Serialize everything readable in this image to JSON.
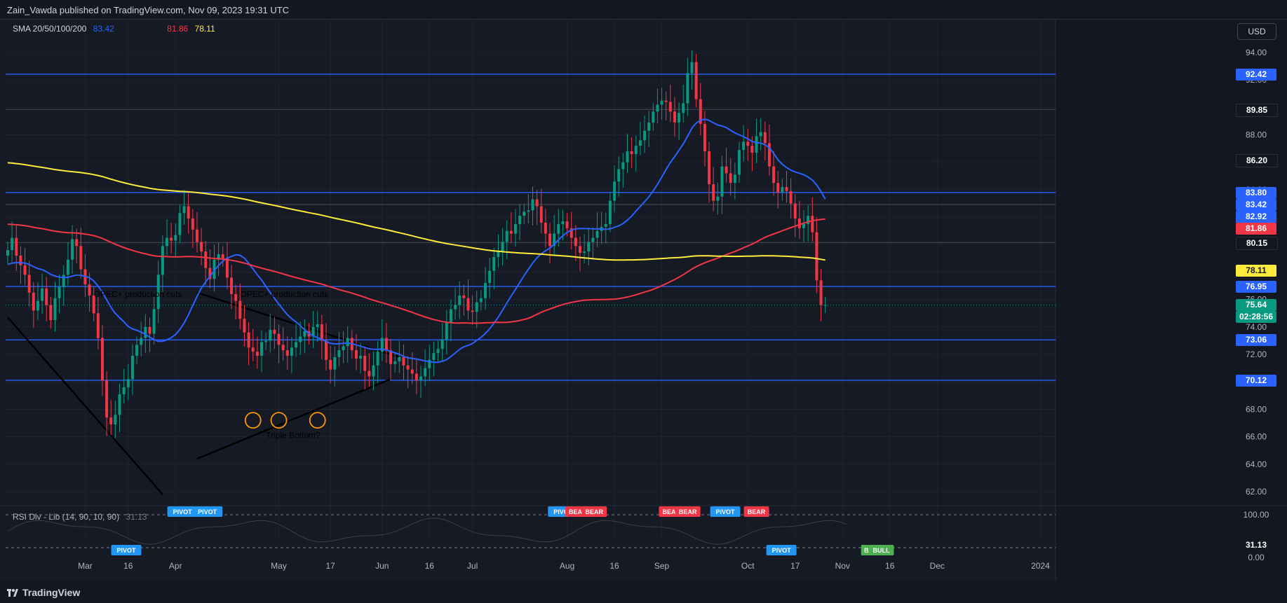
{
  "header": {
    "publisher_line": "Zain_Vawda published on TradingView.com, Nov 09, 2023 19:31 UTC"
  },
  "legend": {
    "sma_label": "SMA 20/50/100/200",
    "sma_values": [
      {
        "value": "83.42",
        "color": "#2962ff"
      },
      {
        "value": "81.86",
        "color": "#f23645"
      },
      {
        "value": "78.11",
        "color": "#ffeb3b"
      }
    ],
    "rsi_label": "RSI Div - Lib (14, 90, 10, 90)",
    "rsi_value": "31.13"
  },
  "toolbar": {
    "currency": "USD"
  },
  "footer": {
    "brand": "TradingView"
  },
  "colors": {
    "background": "#161a25",
    "grid": "#1f2330",
    "sma20": "#2962ff",
    "sma100": "#f23645",
    "sma200": "#ffeb3b",
    "up_candle": "#089981",
    "down_candle": "#f23645",
    "hline": "#2962ff",
    "bear_tag": "#f23645",
    "bull_tag": "#4caf50",
    "pivot_tag": "#2196f3"
  },
  "chart_data": {
    "type": "candlestick",
    "title": "",
    "price_axis_ticks": [
      "94.00",
      "92.00",
      "90.00",
      "88.00",
      "86.00",
      "84.00",
      "82.00",
      "80.00",
      "78.00",
      "76.00",
      "74.00",
      "72.00",
      "70.00",
      "68.00",
      "66.00",
      "64.00",
      "62.00"
    ],
    "time_axis_labels": [
      {
        "label": "Mar",
        "idx": 18
      },
      {
        "label": "16",
        "idx": 28
      },
      {
        "label": "Apr",
        "idx": 39
      },
      {
        "label": "May",
        "idx": 63
      },
      {
        "label": "17",
        "idx": 75
      },
      {
        "label": "Jun",
        "idx": 87
      },
      {
        "label": "16",
        "idx": 98
      },
      {
        "label": "Jul",
        "idx": 108
      },
      {
        "label": "Aug",
        "idx": 130
      },
      {
        "label": "16",
        "idx": 141
      },
      {
        "label": "Sep",
        "idx": 152
      },
      {
        "label": "Oct",
        "idx": 172
      },
      {
        "label": "17",
        "idx": 183
      },
      {
        "label": "Nov",
        "idx": 194
      },
      {
        "label": "16",
        "idx": 205
      },
      {
        "label": "Dec",
        "idx": 216
      },
      {
        "label": "2024",
        "idx": 240
      }
    ],
    "ohlc_close_path": [
      79.6,
      80.5,
      79.2,
      78.5,
      77.8,
      76.5,
      75.2,
      75.9,
      76.8,
      75.6,
      74.5,
      76.1,
      76.9,
      77.8,
      78.9,
      80.4,
      79.9,
      78.2,
      77.1,
      76.3,
      75.0,
      73.2,
      70.1,
      67.4,
      66.9,
      67.6,
      69.1,
      69.6,
      70.2,
      71.9,
      72.7,
      73.2,
      74.0,
      73.5,
      75.3,
      77.8,
      79.9,
      80.5,
      80.3,
      80.7,
      82.3,
      82.8,
      81.9,
      81.1,
      80.2,
      79.5,
      78.3,
      77.5,
      78.9,
      79.3,
      79.0,
      77.6,
      76.4,
      75.9,
      74.6,
      73.6,
      72.5,
      72.2,
      71.9,
      72.9,
      73.0,
      73.8,
      73.5,
      72.7,
      72.3,
      71.9,
      72.5,
      72.9,
      73.3,
      73.7,
      73.3,
      74.0,
      74.2,
      73.0,
      71.6,
      70.9,
      71.8,
      72.3,
      72.6,
      73.2,
      72.3,
      71.7,
      71.9,
      70.8,
      70.4,
      71.2,
      72.2,
      73.2,
      72.3,
      71.3,
      71.5,
      71.8,
      71.2,
      70.9,
      70.6,
      70.1,
      70.4,
      71.0,
      71.6,
      72.1,
      72.4,
      73.1,
      74.3,
      75.3,
      75.6,
      76.3,
      76.1,
      75.2,
      75.1,
      75.8,
      76.1,
      77.2,
      78.1,
      79.1,
      79.5,
      80.2,
      81.0,
      80.8,
      81.5,
      82.1,
      82.4,
      82.5,
      83.3,
      82.8,
      81.6,
      80.8,
      79.9,
      80.8,
      81.5,
      81.7,
      81.2,
      80.5,
      79.9,
      79.4,
      79.5,
      80.2,
      80.5,
      81.0,
      81.3,
      81.5,
      83.2,
      84.6,
      85.5,
      86.0,
      86.8,
      86.6,
      87.2,
      87.6,
      88.3,
      88.9,
      89.7,
      90.2,
      90.5,
      90.4,
      89.7,
      88.9,
      89.6,
      90.3,
      92.5,
      93.3,
      90.6,
      88.8,
      86.8,
      84.4,
      83.2,
      83.5,
      85.7,
      85.2,
      84.5,
      85.1,
      86.9,
      87.5,
      87.2,
      86.7,
      87.9,
      88.2,
      87.4,
      85.7,
      84.5,
      83.8,
      84.2,
      83.9,
      83.0,
      81.9,
      81.2,
      81.5,
      82.1,
      80.9,
      77.4,
      75.6,
      75.6
    ],
    "hlines": [
      {
        "price": "92.42",
        "style": "solid",
        "color": "#2962ff"
      },
      {
        "price": "89.85",
        "style": "solid",
        "color": "#3b3f4a"
      },
      {
        "price": "86.20",
        "style": "none",
        "color": "#3b3f4a"
      },
      {
        "price": "83.80",
        "style": "solid",
        "color": "#2962ff"
      },
      {
        "price": "82.92",
        "style": "solid",
        "color": "#3b3f4a"
      },
      {
        "price": "80.15",
        "style": "solid",
        "color": "#3b3f4a"
      },
      {
        "price": "76.95",
        "style": "solid",
        "color": "#2962ff"
      },
      {
        "price": "73.06",
        "style": "solid",
        "color": "#2962ff"
      },
      {
        "price": "70.12",
        "style": "solid",
        "color": "#2962ff"
      }
    ],
    "price_tags": [
      {
        "label": "92.42",
        "bg": "#2962ff",
        "fg": "#ffffff",
        "price": 92.42
      },
      {
        "label": "89.85",
        "bg": "#131722",
        "fg": "#ffffff",
        "price": 89.85
      },
      {
        "label": "86.20",
        "bg": "#131722",
        "fg": "#ffffff",
        "price": 86.2
      },
      {
        "label": "83.80",
        "bg": "#2962ff",
        "fg": "#ffffff",
        "price": 83.8
      },
      {
        "label": "83.42",
        "bg": "#2962ff",
        "fg": "#ffffff",
        "price": 83.42
      },
      {
        "label": "82.92",
        "bg": "#2962ff",
        "fg": "#ffffff",
        "price": 82.92
      },
      {
        "label": "81.86",
        "bg": "#f23645",
        "fg": "#ffffff",
        "price": 81.86
      },
      {
        "label": "80.15",
        "bg": "#131722",
        "fg": "#ffffff",
        "price": 80.15
      },
      {
        "label": "78.11",
        "bg": "#ffeb3b",
        "fg": "#131722",
        "price": 78.11
      },
      {
        "label": "76.95",
        "bg": "#2962ff",
        "fg": "#ffffff",
        "price": 76.95
      },
      {
        "label": "75.64",
        "bg": "#089981",
        "fg": "#ffffff",
        "price": 75.64
      },
      {
        "label": "02:28:56",
        "bg": "#089981",
        "fg": "#ffffff",
        "price": 74.9
      },
      {
        "label": "73.06",
        "bg": "#2962ff",
        "fg": "#ffffff",
        "price": 73.06
      },
      {
        "label": "70.12",
        "bg": "#2962ff",
        "fg": "#ffffff",
        "price": 70.12
      }
    ],
    "annotations": [
      {
        "text": "OPEC+ production cuts",
        "idx": 20,
        "price": 76.2
      },
      {
        "text": "OPEC+ production cuts",
        "idx": 54,
        "price": 76.2
      },
      {
        "text": "Triple Bottom?",
        "idx": 60,
        "price": 65.9
      }
    ],
    "triple_bottom_circles": [
      {
        "idx": 57,
        "price": 67.2
      },
      {
        "idx": 63,
        "price": 67.2
      },
      {
        "idx": 72,
        "price": 67.2
      }
    ],
    "rsi_panel": {
      "levels": [
        "100.00",
        "0.00"
      ],
      "current": "31.13",
      "tags": [
        {
          "text": "PIVOT",
          "type": "pivot",
          "idx": 19,
          "pos": "low"
        },
        {
          "text": "PIVOT",
          "type": "pivot",
          "idx": 28,
          "pos": "high"
        },
        {
          "text": "PIVOT",
          "type": "pivot",
          "idx": 32,
          "pos": "high"
        },
        {
          "text": "PIVOT",
          "type": "pivot",
          "idx": 89,
          "pos": "high"
        },
        {
          "text": "BEA",
          "type": "bear",
          "idx": 91,
          "pos": "high"
        },
        {
          "text": "BEAR",
          "type": "bear",
          "idx": 94,
          "pos": "high"
        },
        {
          "text": "BEA",
          "type": "bear",
          "idx": 106,
          "pos": "high"
        },
        {
          "text": "BEAR",
          "type": "bear",
          "idx": 109,
          "pos": "high"
        },
        {
          "text": "PIVOT",
          "type": "pivot",
          "idx": 115,
          "pos": "high"
        },
        {
          "text": "BEAR",
          "type": "bear",
          "idx": 120,
          "pos": "high"
        },
        {
          "text": "PIVOT",
          "type": "pivot",
          "idx": 124,
          "pos": "low"
        },
        {
          "text": "BU",
          "type": "bull",
          "idx": 138,
          "pos": "low"
        },
        {
          "text": "BULL",
          "type": "bull",
          "idx": 140,
          "pos": "low"
        }
      ]
    }
  }
}
